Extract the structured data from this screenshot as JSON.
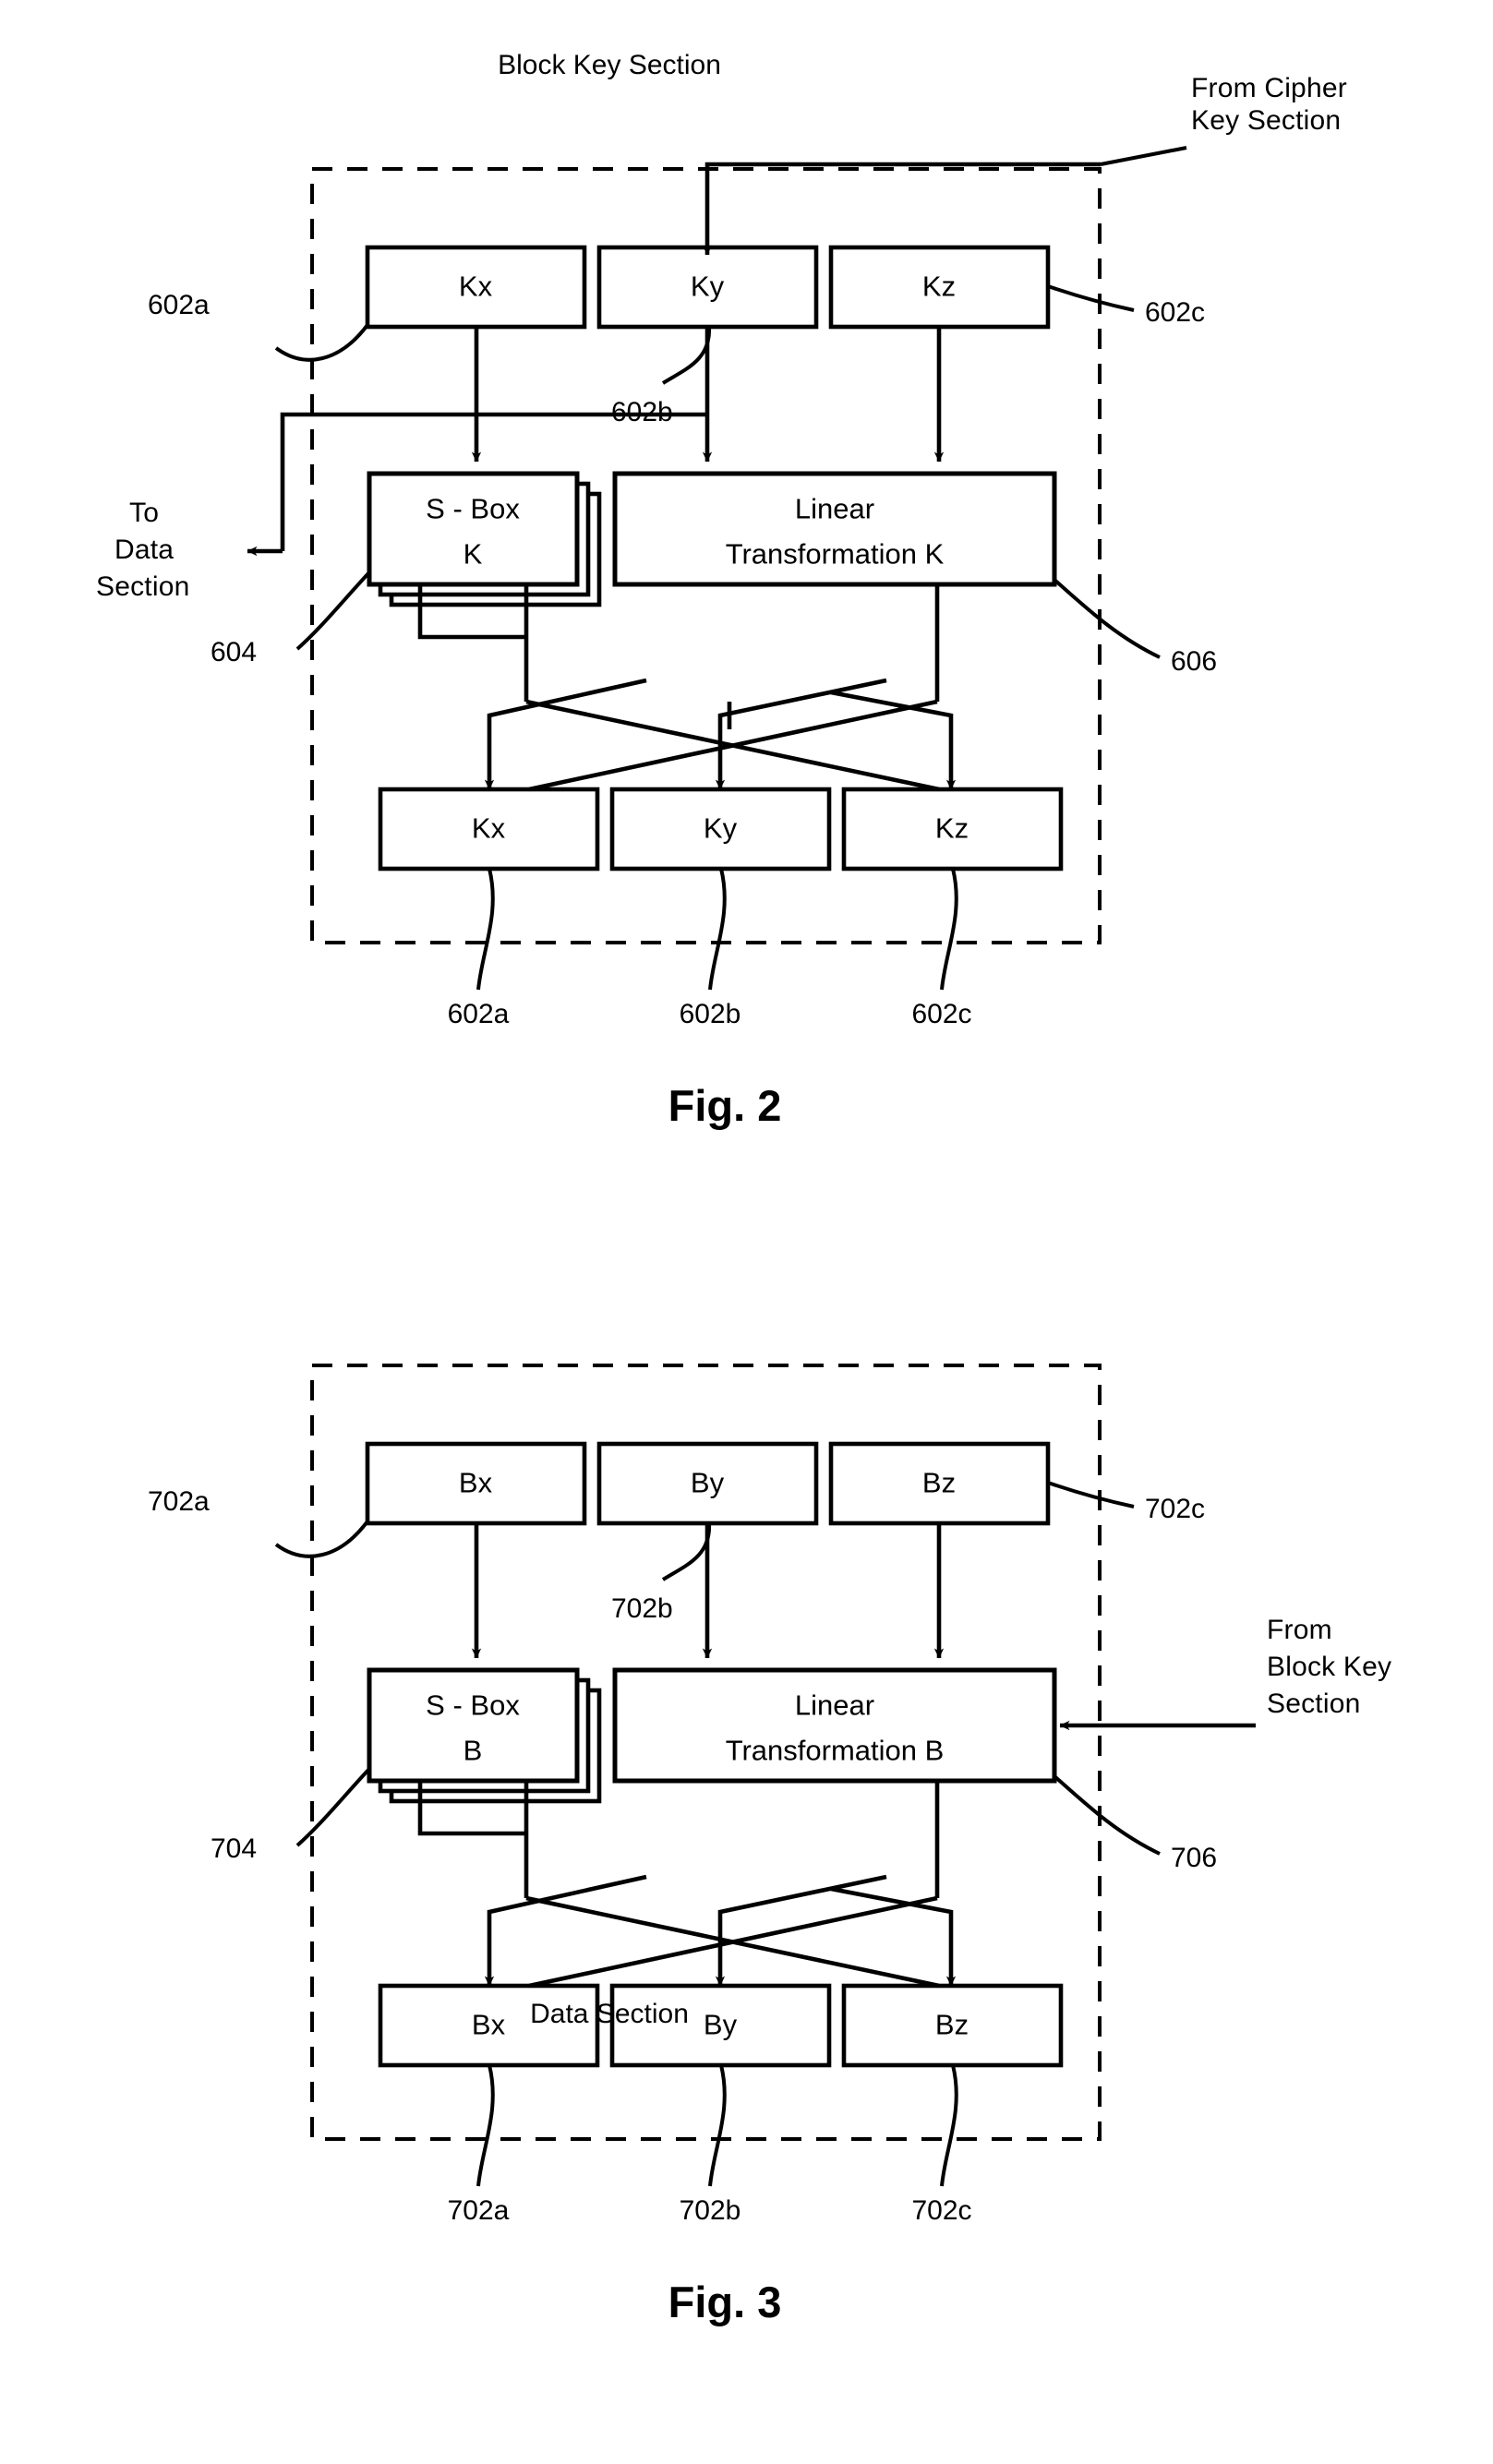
{
  "document": {
    "type": "patent-figure-sheet",
    "figures": [
      {
        "id": "fig2",
        "caption": "Fig. 2",
        "section_title": "Block Key Section",
        "external_labels": {
          "from": "From Cipher\nKey Section",
          "to": "To\nData\nSection"
        },
        "input_boxes": [
          {
            "label": "Kx",
            "ref": "602a"
          },
          {
            "label": "Ky",
            "ref": "602b"
          },
          {
            "label": "Kz",
            "ref": "602c"
          }
        ],
        "process_boxes": [
          {
            "label": "S - Box\nK",
            "ref": "604"
          },
          {
            "label": "Linear\nTransformation K",
            "ref": "606"
          }
        ],
        "output_boxes": [
          {
            "label": "Kx",
            "ref": "602a"
          },
          {
            "label": "Ky",
            "ref": "602b"
          },
          {
            "label": "Kz",
            "ref": "602c"
          }
        ]
      },
      {
        "id": "fig3",
        "caption": "Fig. 3",
        "section_title": "Data Section",
        "external_labels": {
          "from": "From\nBlock Key\nSection"
        },
        "input_boxes": [
          {
            "label": "Bx",
            "ref": "702a"
          },
          {
            "label": "By",
            "ref": "702b"
          },
          {
            "label": "Bz",
            "ref": "702c"
          }
        ],
        "process_boxes": [
          {
            "label": "S - Box\nB",
            "ref": "704"
          },
          {
            "label": "Linear\nTransformation B",
            "ref": "706"
          }
        ],
        "output_boxes": [
          {
            "label": "Bx",
            "ref": "702a"
          },
          {
            "label": "By",
            "ref": "702b"
          },
          {
            "label": "Bz",
            "ref": "702c"
          }
        ]
      }
    ]
  },
  "fig2": {
    "caption": "Fig. 2",
    "section_title": "Block Key Section",
    "from_label_line1": "From Cipher",
    "from_label_line2": "Key Section",
    "to_label_line1": "To",
    "to_label_line2": "Data",
    "to_label_line3": "Section",
    "in_x": "Kx",
    "in_y": "Ky",
    "in_z": "Kz",
    "sbox_line1": "S - Box",
    "sbox_line2": "K",
    "lin_line1": "Linear",
    "lin_line2": "Transformation K",
    "out_x": "Kx",
    "out_y": "Ky",
    "out_z": "Kz",
    "ref_in_a": "602a",
    "ref_in_b": "602b",
    "ref_in_c": "602c",
    "ref_sbox": "604",
    "ref_lin": "606",
    "ref_out_a": "602a",
    "ref_out_b": "602b",
    "ref_out_c": "602c"
  },
  "fig3": {
    "caption": "Fig. 3",
    "section_title": "Data Section",
    "from_label_line1": "From",
    "from_label_line2": "Block Key",
    "from_label_line3": "Section",
    "in_x": "Bx",
    "in_y": "By",
    "in_z": "Bz",
    "sbox_line1": "S - Box",
    "sbox_line2": "B",
    "lin_line1": "Linear",
    "lin_line2": "Transformation B",
    "out_x": "Bx",
    "out_y": "By",
    "out_z": "Bz",
    "ref_in_a": "702a",
    "ref_in_b": "702b",
    "ref_in_c": "702c",
    "ref_sbox": "704",
    "ref_lin": "706",
    "ref_out_a": "702a",
    "ref_out_b": "702b",
    "ref_out_c": "702c"
  },
  "colors": {
    "ink": "#000000",
    "paper": "#ffffff"
  }
}
